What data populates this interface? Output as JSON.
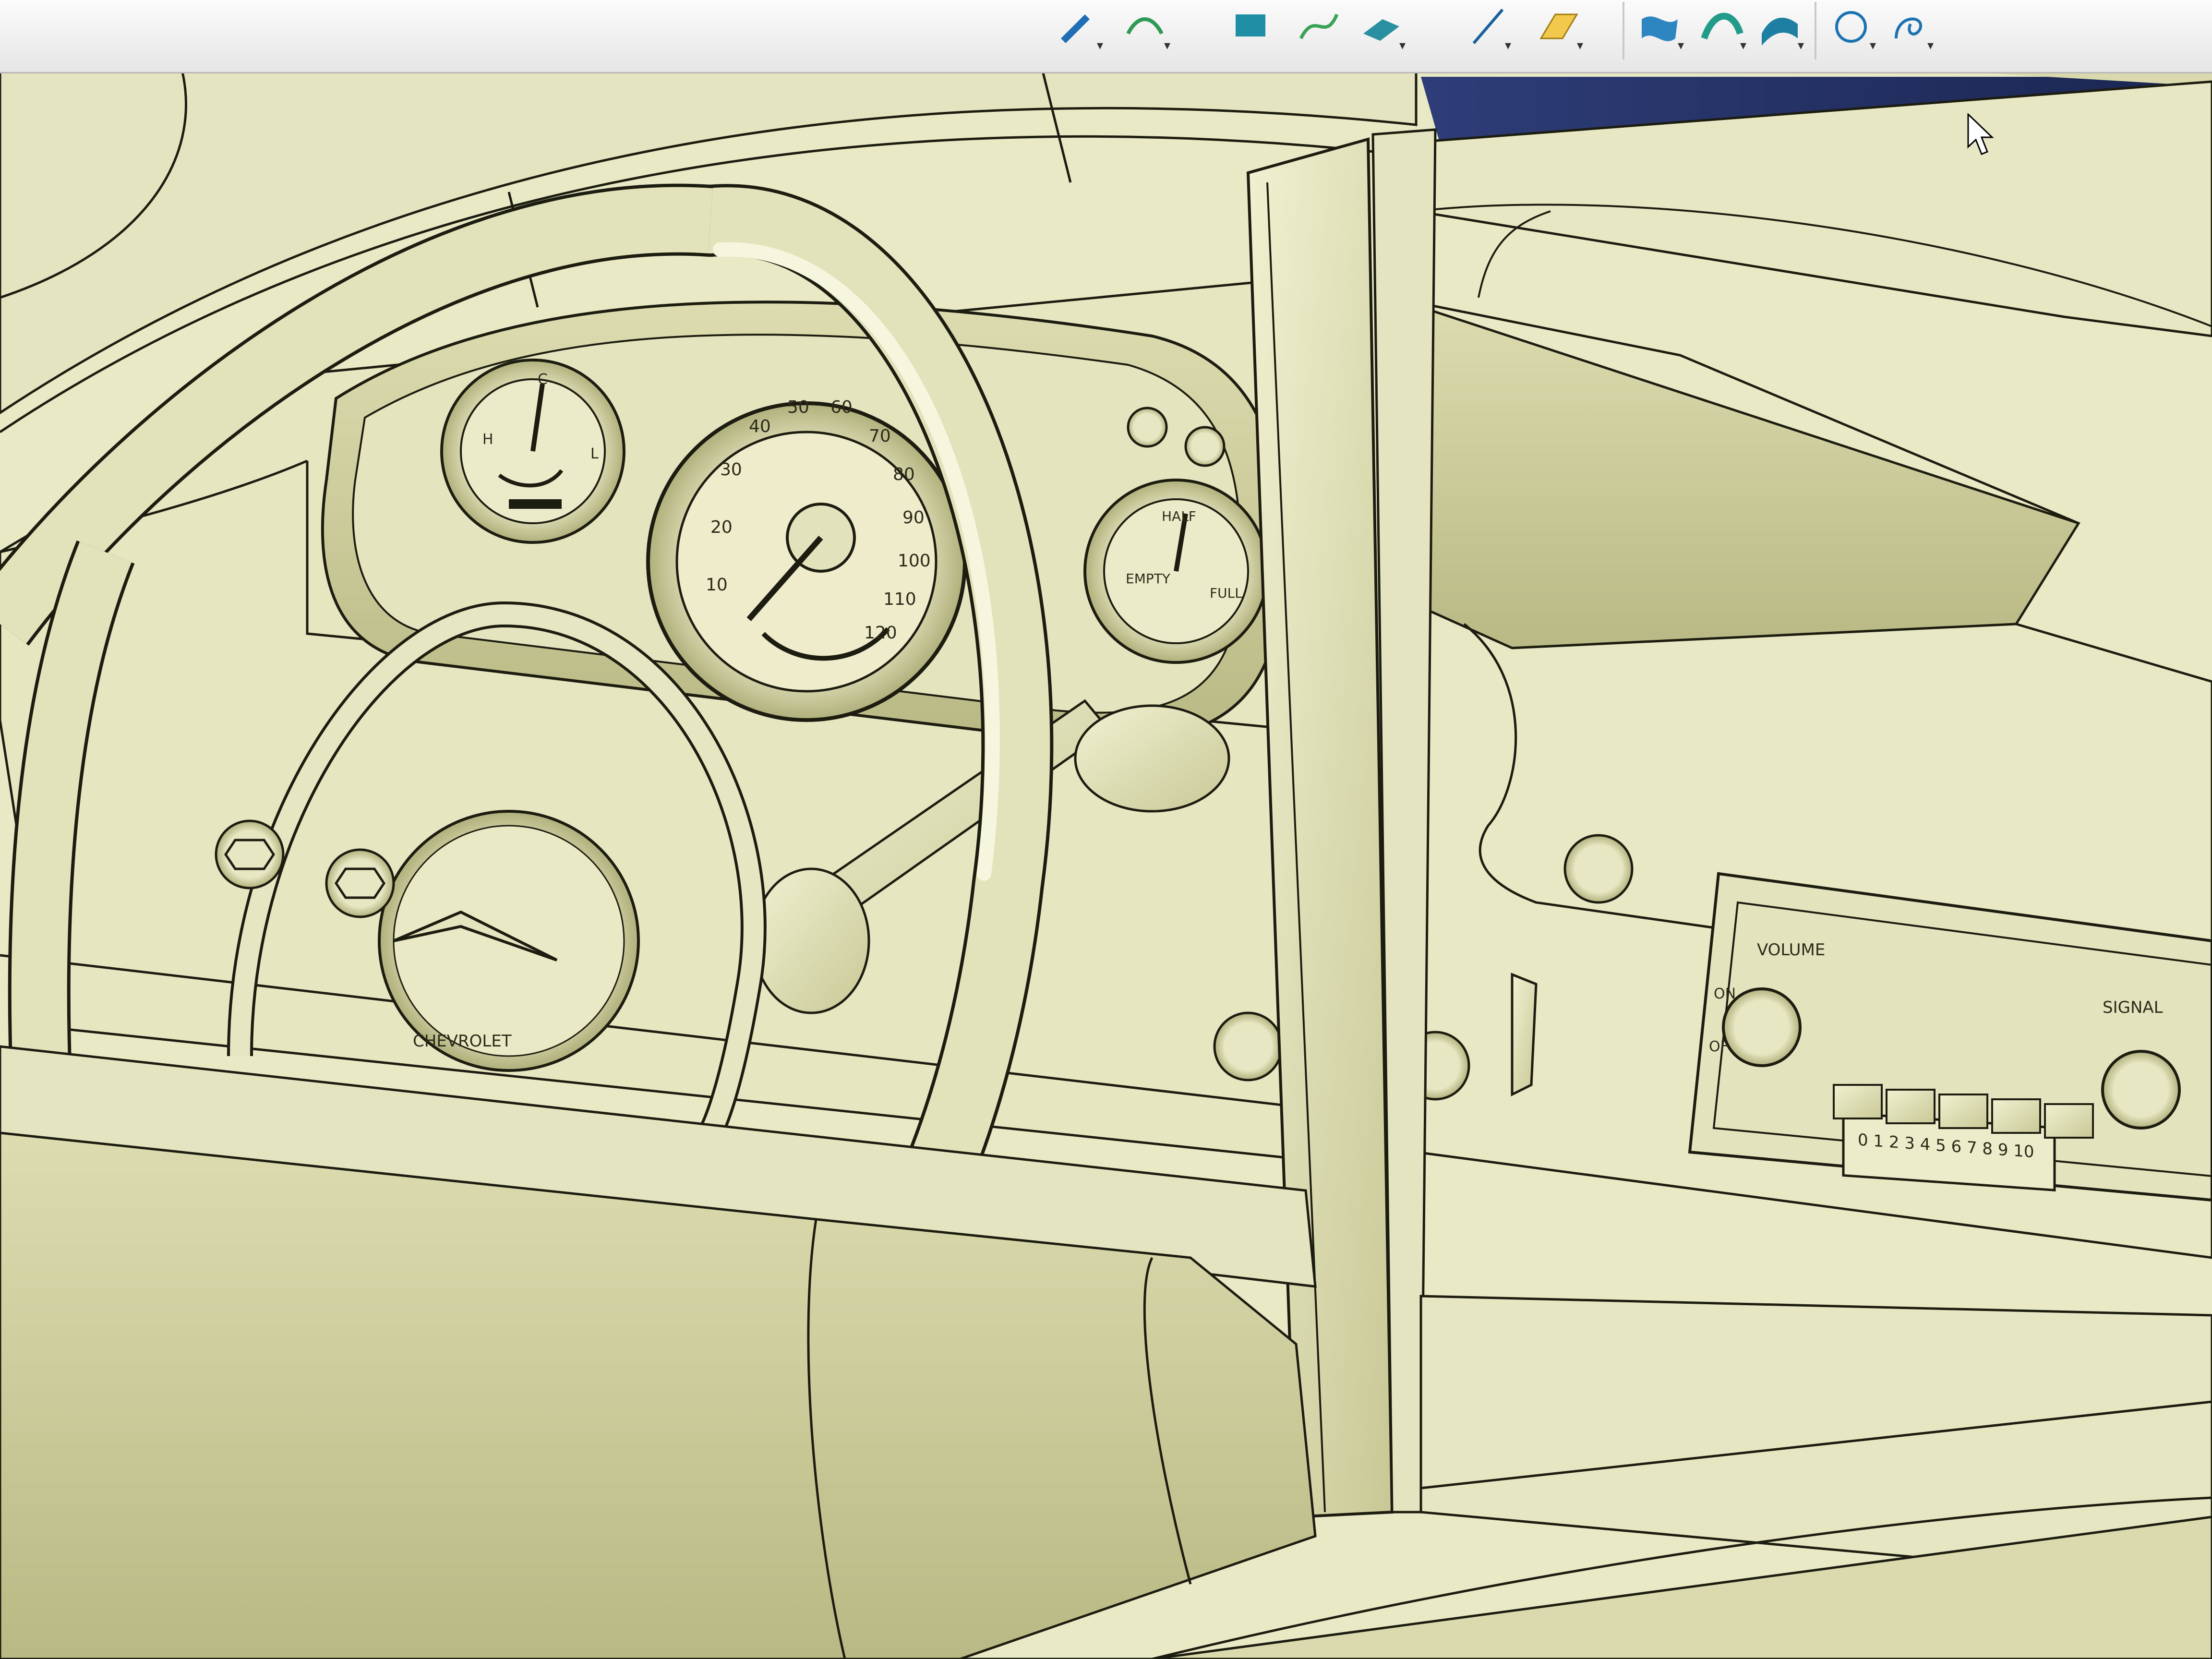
{
  "toolbar": {
    "icons": [
      "arrow-icon",
      "arrow-icon",
      "face-icon",
      "curve-icon",
      "plane-icon",
      "line-icon",
      "parallelogram-icon",
      "loft-surface-icon",
      "sweep-surface-icon",
      "blend-surface-icon",
      "circle-icon",
      "spline-icon"
    ]
  },
  "gauges": {
    "fuel_left": {
      "tick_labels": [
        "H",
        "C",
        "L"
      ]
    },
    "speedometer": {
      "tick_labels": [
        "10",
        "20",
        "30",
        "40",
        "50",
        "60",
        "70",
        "80",
        "90",
        "100",
        "110",
        "120"
      ]
    },
    "fuel_right": {
      "tick_labels": [
        "EMPTY",
        "HALF",
        "FULL"
      ]
    }
  },
  "radio": {
    "volume_label": "VOLUME",
    "on_label": "ON",
    "off_label": "OFF",
    "signal_label": "SIGNAL",
    "dial_numbers": "0 1 2 3 4 5 6 7 8 9 10"
  },
  "horn": {
    "badge": "CHEVROLET"
  },
  "colors": {
    "model_surface": "#e9e9c6",
    "model_shadow": "#a8a874",
    "edge_line": "#1c1c10",
    "background_blue": "#1f2d5c",
    "toolbar": "#f2f2f2"
  }
}
